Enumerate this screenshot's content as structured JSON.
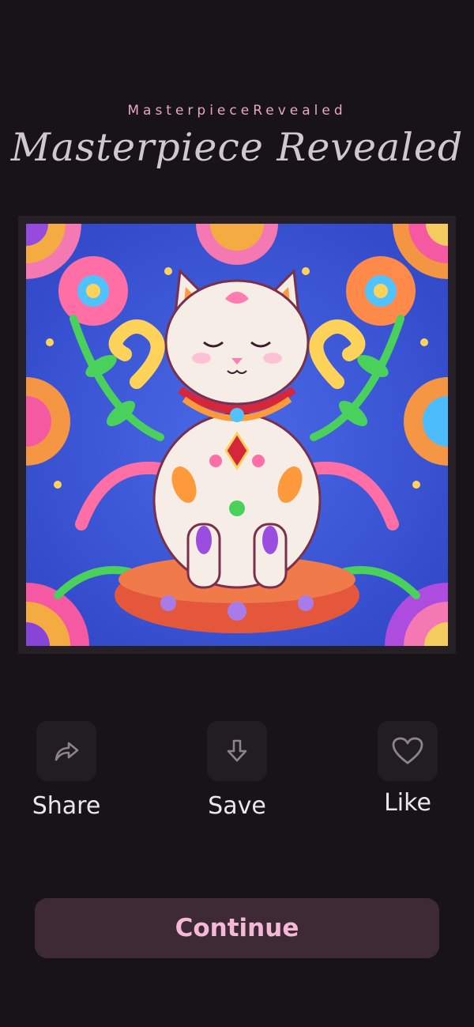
{
  "header": {
    "eyebrow": "MasterpieceRevealed",
    "title": "Masterpiece Revealed"
  },
  "artwork": {
    "subject": "colorful mandala cat illustration",
    "colors": {
      "background": "#3a57d6",
      "cat": "#f6eee6",
      "cushion": "#e4573b",
      "frame": "#262026"
    }
  },
  "actions": [
    {
      "id": "share",
      "label": "Share",
      "icon": "share-arrow-icon"
    },
    {
      "id": "save",
      "label": "Save",
      "icon": "download-arrow-icon"
    },
    {
      "id": "like",
      "label": "Like",
      "icon": "heart-icon"
    }
  ],
  "continue_button": {
    "label": "Continue"
  },
  "theme": {
    "background": "#171317",
    "accent": "#f4b9d7",
    "button_bg": "#3e2a35"
  }
}
